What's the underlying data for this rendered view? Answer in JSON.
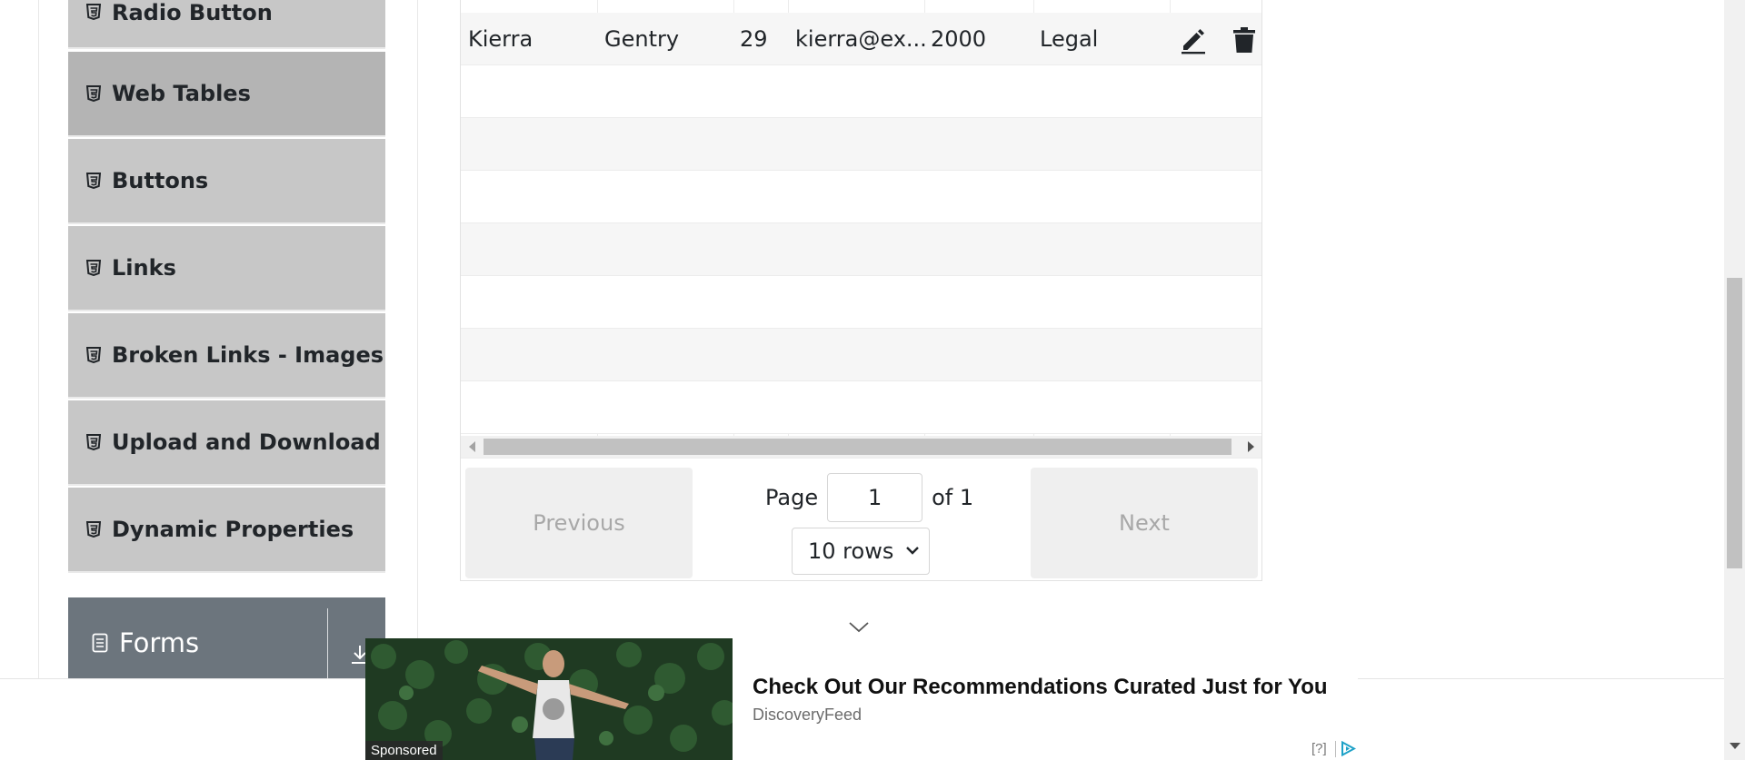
{
  "sidebar": {
    "items": [
      {
        "label": "Radio Button",
        "icon": "html5-icon"
      },
      {
        "label": "Web Tables",
        "icon": "html5-icon",
        "active": true
      },
      {
        "label": "Buttons",
        "icon": "html5-icon"
      },
      {
        "label": "Links",
        "icon": "html5-icon"
      },
      {
        "label": "Broken Links - Images",
        "icon": "html5-icon"
      },
      {
        "label": "Upload and Download",
        "icon": "html5-icon"
      },
      {
        "label": "Dynamic Properties",
        "icon": "html5-icon"
      }
    ],
    "next_group": {
      "label": "Forms",
      "icon": "document-icon",
      "toggle_icon": "arrow-down-icon"
    }
  },
  "table": {
    "rows": [
      {
        "first_name": "Kierra",
        "last_name": "Gentry",
        "age": "29",
        "email": "kierra@ex...",
        "salary": "2000",
        "department": "Legal"
      }
    ],
    "empty_rows": 7,
    "actions": {
      "edit_icon": "pencil-icon",
      "delete_icon": "trash-icon"
    }
  },
  "pagination": {
    "previous_label": "Previous",
    "next_label": "Next",
    "page_label": "Page",
    "page_value": "1",
    "of_label": "of 1",
    "rows_selected": "10 rows"
  },
  "ad": {
    "title": "Check Out Our Recommendations Curated Just for You",
    "source": "DiscoveryFeed",
    "sponsored_label": "Sponsored",
    "help_label": "[?]"
  },
  "colors": {
    "sidebar_item": "#c7c7c7",
    "sidebar_item_active": "#b4b4b4",
    "group_header": "#6c757d",
    "button_disabled_bg": "#efefef",
    "button_disabled_text": "#a8a8a8"
  }
}
